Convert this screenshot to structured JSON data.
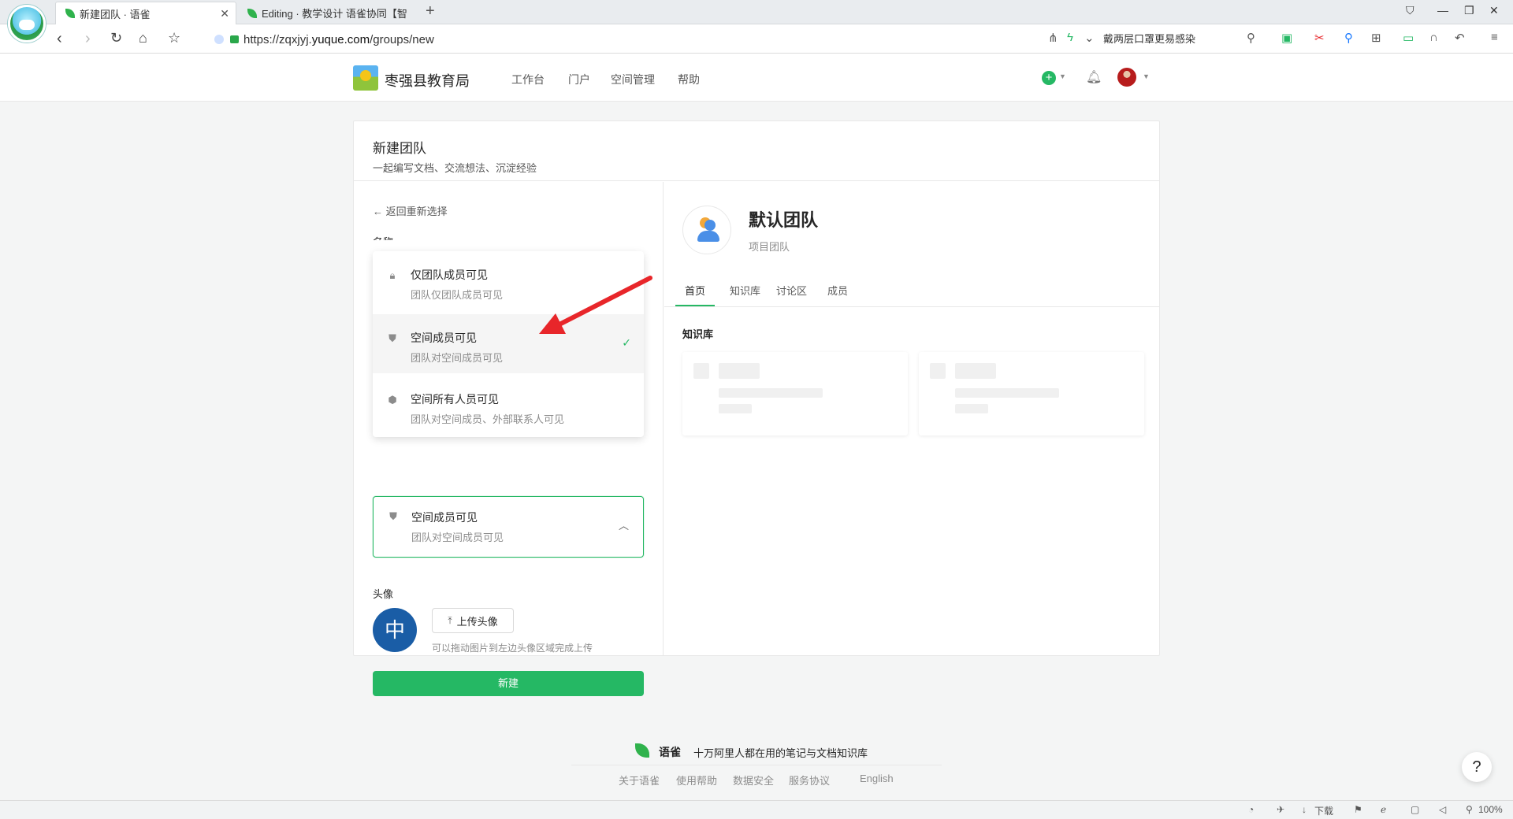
{
  "browser": {
    "tabs": [
      {
        "title": "新建团队 · 语雀",
        "active": true
      },
      {
        "title": "Editing · 教学设计 语雀协同【智",
        "active": false
      }
    ],
    "new_tab": "+",
    "url_prefix": "https://zqxjyj.",
    "url_host": "yuque.com",
    "url_path": "/groups/new",
    "search_text": "戴两层口罩更易感染",
    "status": {
      "download": "下载",
      "zoom": "100%"
    }
  },
  "header": {
    "org_name": "枣强县教育局",
    "nav": [
      "工作台",
      "门户",
      "空间管理",
      "帮助"
    ]
  },
  "form": {
    "title": "新建团队",
    "subtitle": "一起编写文档、交流想法、沉淀经验",
    "back_link": "返回重新选择",
    "name_label": "名称",
    "visibility_options": [
      {
        "title": "仅团队成员可见",
        "desc": "团队仅团队成员可见",
        "icon": "lock-icon",
        "selected": false
      },
      {
        "title": "空间成员可见",
        "desc": "团队对空间成员可见",
        "icon": "shield-icon",
        "selected": true
      },
      {
        "title": "空间所有人员可见",
        "desc": "团队对空间成员、外部联系人可见",
        "icon": "cube-icon",
        "selected": false
      }
    ],
    "selected_visibility": {
      "title": "空间成员可见",
      "desc": "团队对空间成员可见"
    },
    "avatar_label": "头像",
    "avatar_char": "中",
    "upload_label": "上传头像",
    "upload_hint": "可以拖动图片到左边头像区域完成上传",
    "create_label": "新建"
  },
  "preview": {
    "team_name": "默认团队",
    "team_type": "项目团队",
    "tabs": [
      "首页",
      "知识库",
      "讨论区",
      "成员"
    ],
    "active_tab": "首页",
    "section_label": "知识库"
  },
  "footer": {
    "brand": "语雀",
    "slogan": "十万阿里人都在用的笔记与文档知识库",
    "links": [
      "关于语雀",
      "使用帮助",
      "数据安全",
      "服务协议",
      "English"
    ],
    "help": "?"
  },
  "colors": {
    "accent": "#25b864",
    "annotation_arrow": "#e8262a"
  }
}
